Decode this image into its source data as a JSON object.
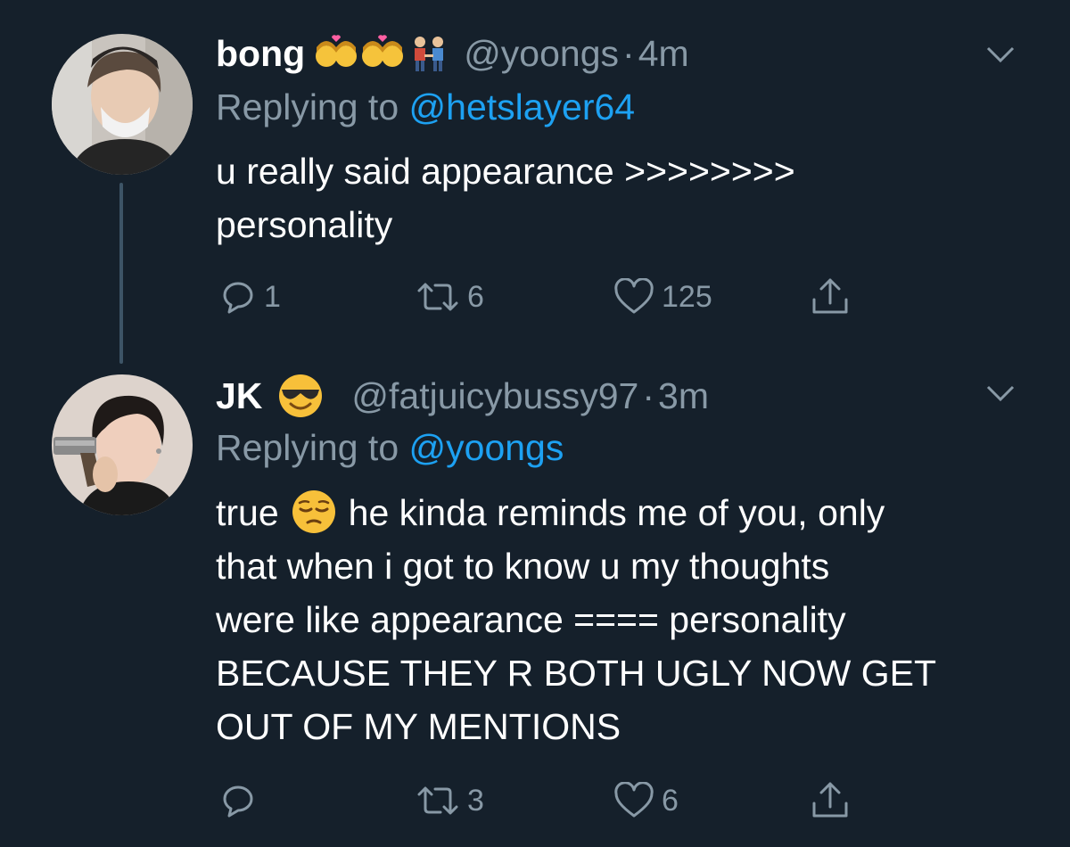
{
  "tweets": [
    {
      "display_name": "bong",
      "handle": "@yoongs",
      "separator": "·",
      "time": "4m",
      "replying_prefix": "Replying to ",
      "replying_to": "@hetslayer64",
      "body_lines": [
        "u really said appearance >>>>>>>>",
        "personality"
      ],
      "reply_count": "1",
      "retweet_count": "6",
      "like_count": "125",
      "name_emojis": [
        "kiss-woman-woman-emoji",
        "kiss-woman-woman-emoji",
        "men-holding-hands-emoji"
      ]
    },
    {
      "display_name": "JK",
      "handle": "@fatjuicybussy97",
      "separator": "·",
      "time": "3m",
      "replying_prefix": "Replying to ",
      "replying_to": "@yoongs",
      "body_first_a": "true",
      "body_first_b": "he kinda reminds me of you, only",
      "body_lines": [
        "that when i got to know u my thoughts",
        "were like appearance ==== personality",
        "BECAUSE THEY R BOTH UGLY NOW GET",
        "OUT OF MY MENTIONS"
      ],
      "reply_count": "",
      "retweet_count": "3",
      "like_count": "6",
      "name_emojis": [
        "sunglasses-face-emoji"
      ],
      "body_emoji": "pensive-face-emoji"
    }
  ],
  "colors": {
    "background": "#15202b",
    "text": "#ffffff",
    "secondary": "#8899a6",
    "link": "#1da1f2",
    "thread_line": "#3d5466"
  }
}
